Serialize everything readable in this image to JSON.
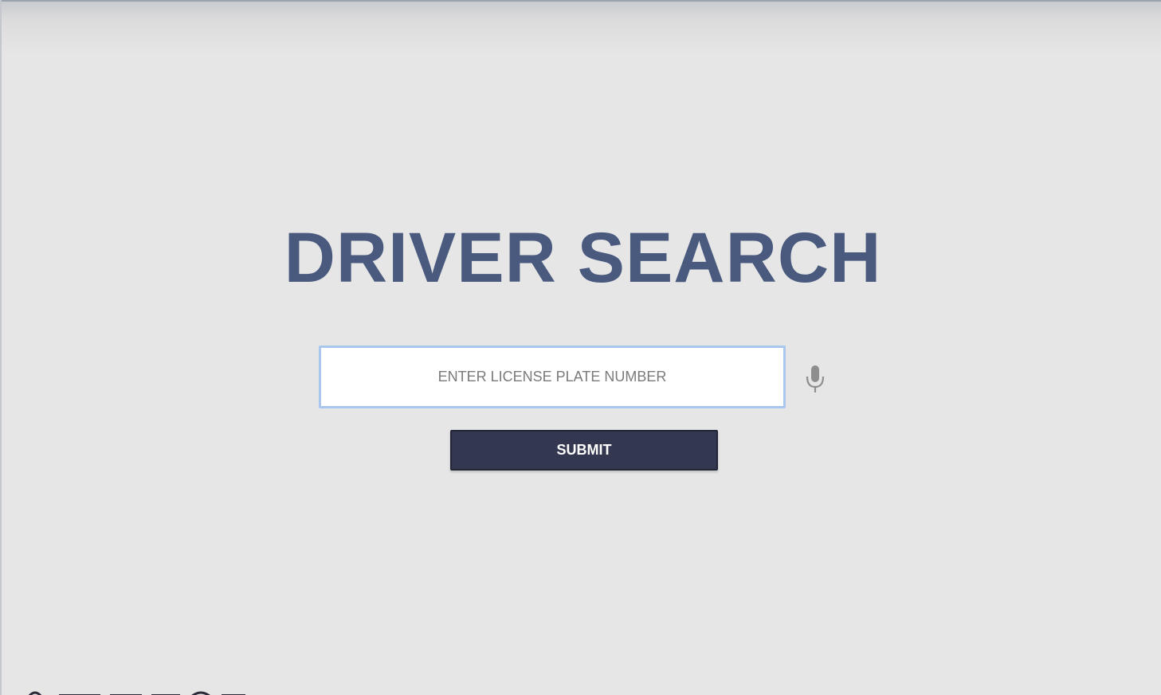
{
  "page": {
    "title": "DRIVER SEARCH",
    "colors": {
      "background": "#e6e6e6",
      "title": "#4a5a7e",
      "input_border": "#a9c6ee",
      "button_bg": "#333750",
      "button_text": "#ffffff"
    }
  },
  "search": {
    "placeholder": "ENTER LICENSE PLATE NUMBER",
    "value": "",
    "mic_icon": "microphone-icon"
  },
  "actions": {
    "submit_label": "SUBMIT"
  }
}
